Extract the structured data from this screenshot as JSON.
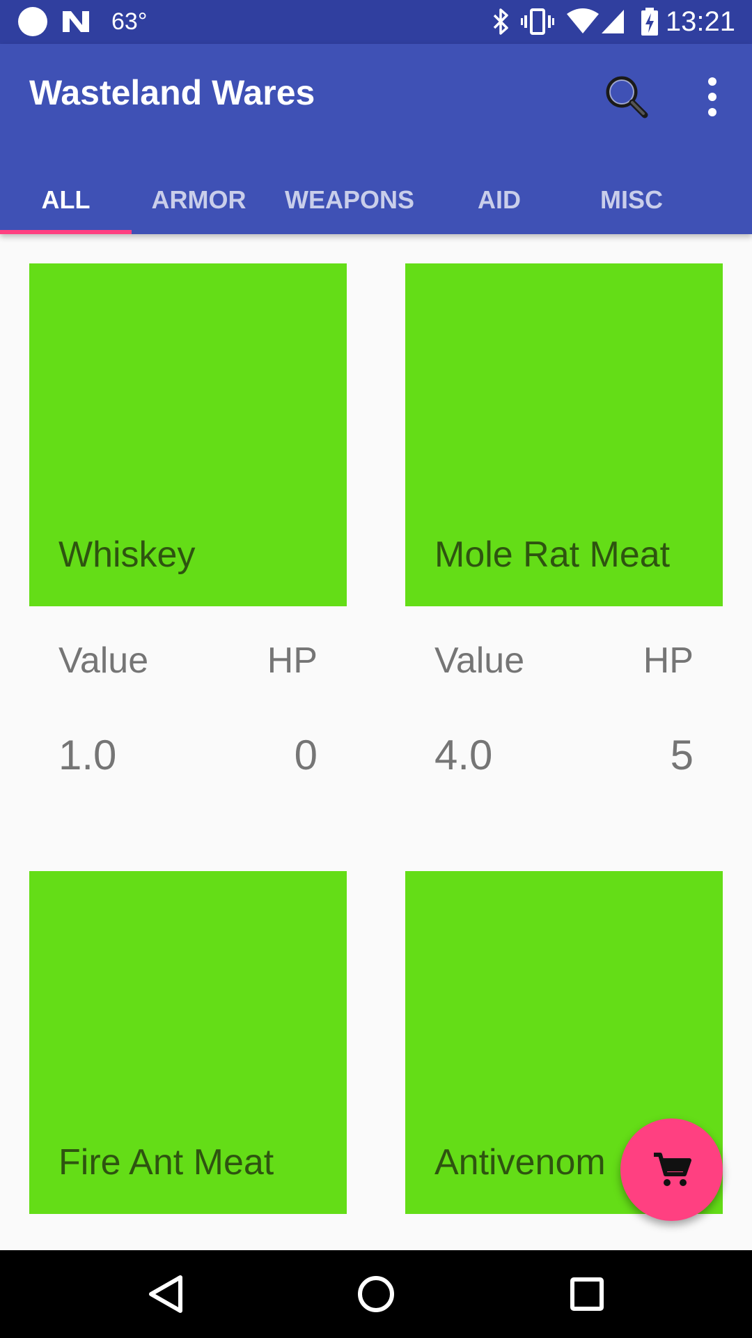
{
  "status_bar": {
    "temperature": "63°",
    "time": "13:21",
    "icons": [
      "circle-notification-icon",
      "n-notification-icon",
      "bluetooth-icon",
      "vibrate-icon",
      "wifi-icon",
      "cell-signal-icon",
      "battery-charging-icon"
    ]
  },
  "app_bar": {
    "title": "Wasteland Wares",
    "search_icon": "search-icon",
    "more_icon": "more-vert-icon"
  },
  "tabs": [
    {
      "label": "ALL",
      "active": true
    },
    {
      "label": "ARMOR",
      "active": false
    },
    {
      "label": "WEAPONS",
      "active": false
    },
    {
      "label": "AID",
      "active": false
    },
    {
      "label": "MISC",
      "active": false
    }
  ],
  "items": [
    {
      "name": "Whiskey",
      "value_label": "Value",
      "hp_label": "HP",
      "value": "1.0",
      "hp": "0"
    },
    {
      "name": "Mole Rat Meat",
      "value_label": "Value",
      "hp_label": "HP",
      "value": "4.0",
      "hp": "5"
    },
    {
      "name": "Fire Ant Meat"
    },
    {
      "name": "Antivenom"
    }
  ],
  "fab": {
    "icon": "shopping-cart-icon"
  },
  "nav_bar": {
    "icons": [
      "back-icon",
      "home-icon",
      "recents-icon"
    ]
  },
  "colors": {
    "primary": "#3F51B5",
    "primary_dark": "#303F9F",
    "accent": "#FF4081",
    "card": "#64DD17"
  }
}
